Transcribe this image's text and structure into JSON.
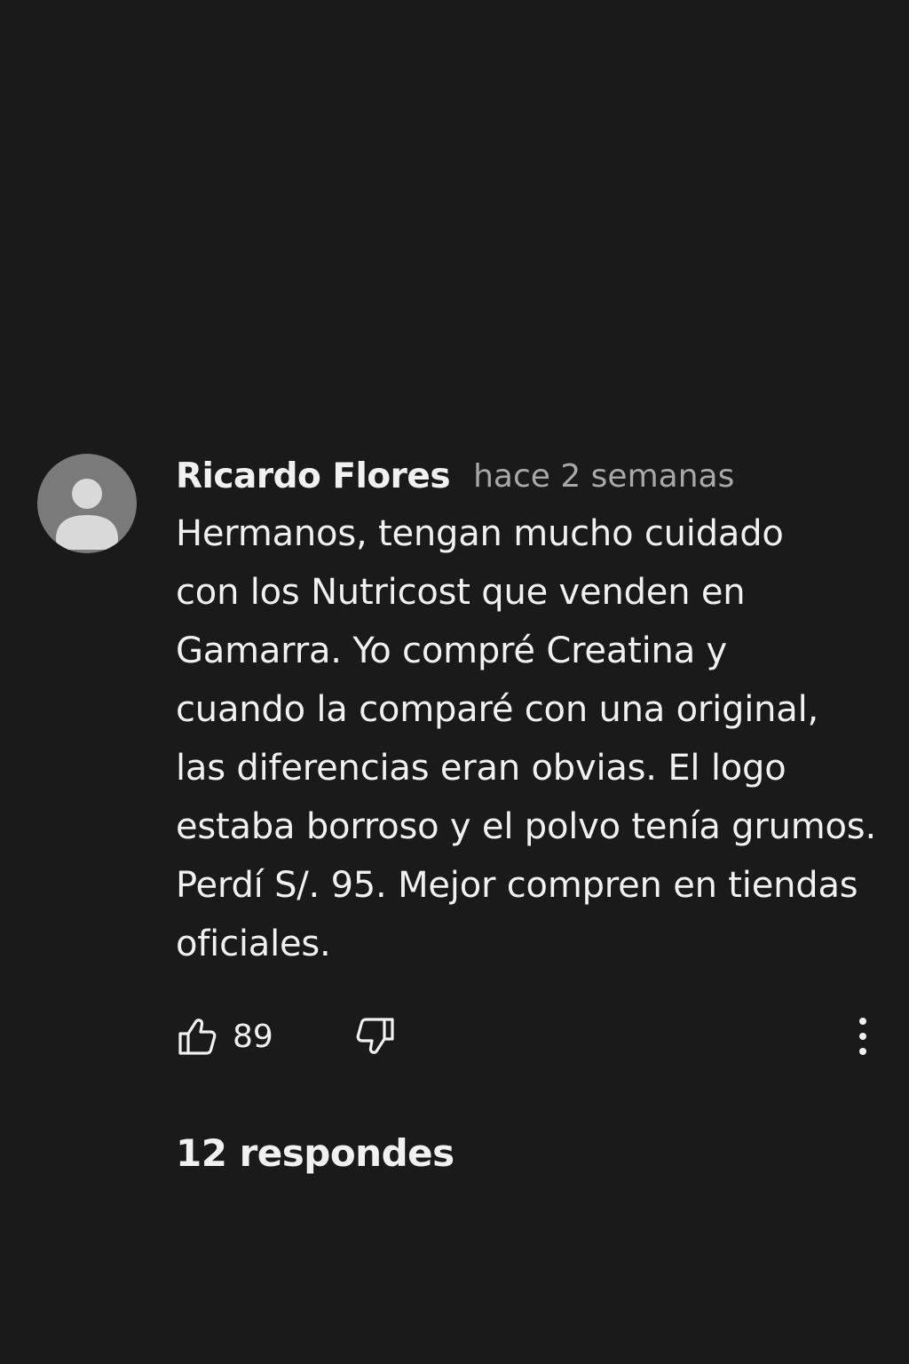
{
  "comment": {
    "author": "Ricardo Flores",
    "timestamp": "hace 2 semanas",
    "body_lines": [
      "Hermanos, tengan mucho cuidado",
      "con los Nutricost que venden en",
      "Gamarra. Yo compré Creatina y",
      "cuando la comparé con una original,",
      "las diferencias eran obvias. El logo",
      "estaba borroso y el polvo tenía grumos.",
      "Perdí S/. 95. Mejor compren en tiendas",
      "oficiales."
    ],
    "like_count": "89",
    "replies_label": "12 respondes"
  },
  "icons": {
    "avatar": "default-user-avatar",
    "like": "thumbs-up-icon",
    "dislike": "thumbs-down-icon",
    "more": "vertical-ellipsis-icon"
  },
  "colors": {
    "background": "#1a1a1b",
    "primary_text": "#f1f1f1",
    "secondary_text": "#a8a8a8",
    "avatar_bg": "#7a7a7a",
    "avatar_figure": "#d9d9d9"
  }
}
